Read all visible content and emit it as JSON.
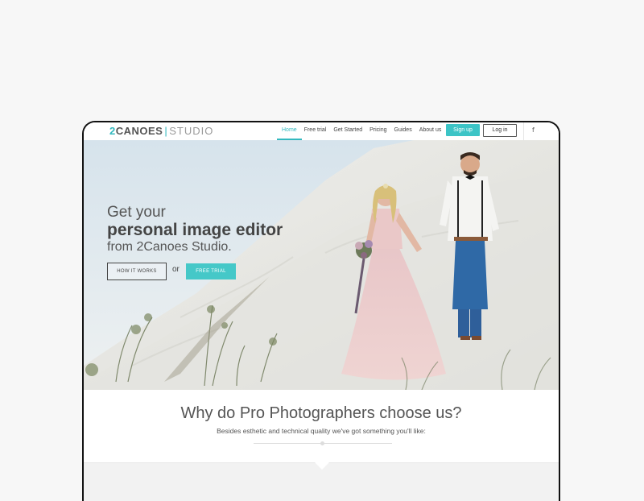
{
  "header": {
    "logo": {
      "part1": "2",
      "part2": "CANOES",
      "separator": "|",
      "part3": "STUDIO"
    },
    "nav": [
      {
        "label": "Home",
        "active": true
      },
      {
        "label": "Free trial",
        "active": false
      },
      {
        "label": "Get Started",
        "active": false
      },
      {
        "label": "Pricing",
        "active": false
      },
      {
        "label": "Guides",
        "active": false
      },
      {
        "label": "About us",
        "active": false
      }
    ],
    "signup_label": "Sign up",
    "login_label": "Log in",
    "social_icon": "facebook-icon",
    "social_glyph": "f"
  },
  "hero": {
    "line1": "Get your",
    "line2": "personal image editor",
    "line3": "from 2Canoes Studio.",
    "how_label": "HOW IT WORKS",
    "or_label": "or",
    "trial_label": "FREE TRIAL"
  },
  "section": {
    "title": "Why do Pro Photographers choose us?",
    "subtitle": "Besides esthetic and technical quality we've got something you'll like:"
  },
  "colors": {
    "accent": "#3cc4c6",
    "text": "#555555",
    "background": "#f7f7f7"
  }
}
